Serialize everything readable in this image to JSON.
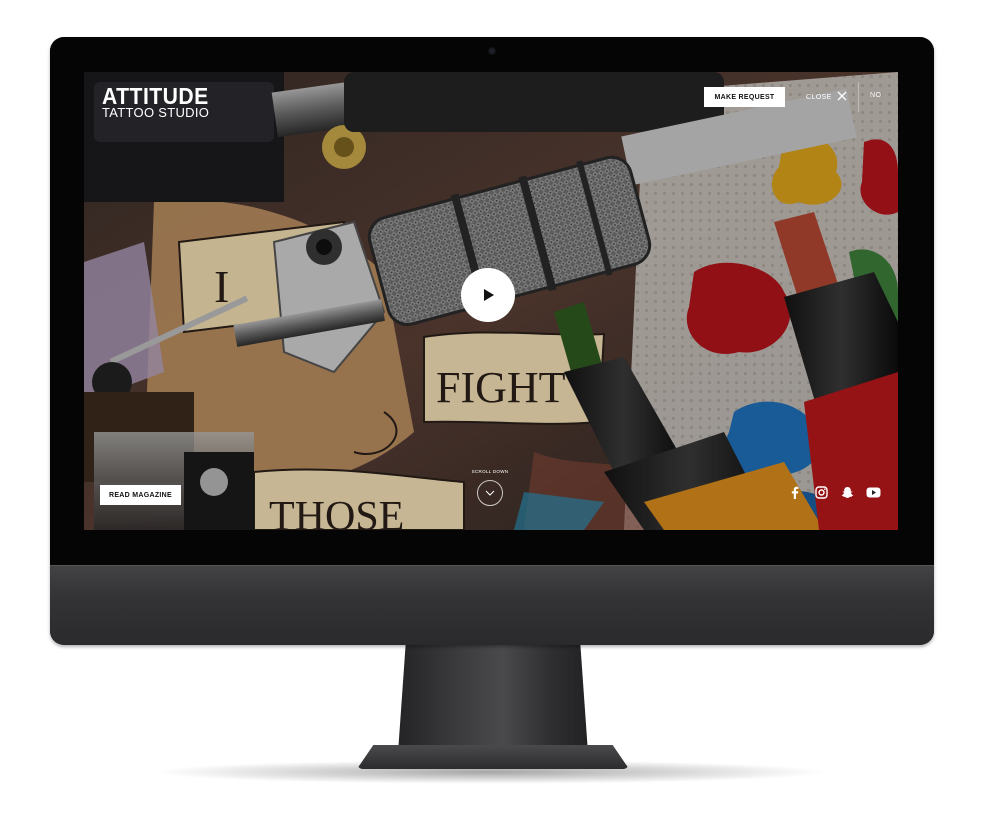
{
  "site": {
    "logo_main": "ATTITUDE",
    "logo_sub": "TATTOO STUDIO"
  },
  "header": {
    "request_label": "MAKE REQUEST",
    "close_label": "CLOSE",
    "language_label": "NO"
  },
  "hero": {
    "banner_word_1": "FIGHT",
    "banner_word_2": "THOSE",
    "banner_word_3": "I",
    "scroll_label": "SCROLL DOWN"
  },
  "footer": {
    "magazine_label": "READ MAGAZINE",
    "socials": [
      "facebook-icon",
      "instagram-icon",
      "snapchat-icon",
      "youtube-icon"
    ]
  },
  "colors": {
    "button_bg": "#ffffff",
    "button_text": "#111111",
    "device_bezel": "#050505",
    "device_body": "#333336"
  }
}
